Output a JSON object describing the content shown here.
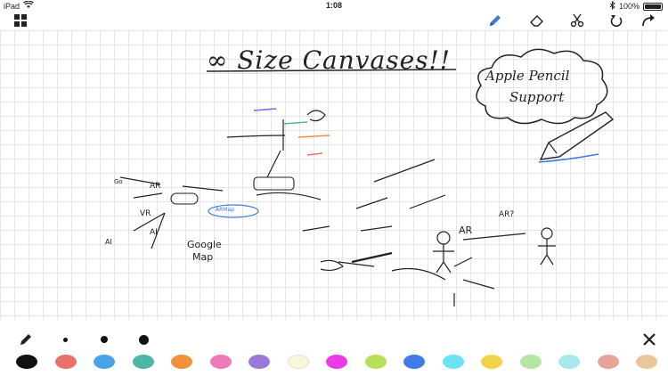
{
  "status_bar": {
    "device": "iPad",
    "time": "1:08",
    "battery_percent": "100%",
    "battery_level": 1.0,
    "icons": [
      "wifi-icon",
      "bluetooth-icon",
      "battery-icon"
    ]
  },
  "toolbar": {
    "left": [
      "grid-menu-icon"
    ],
    "right": [
      "pen-icon",
      "eraser-icon",
      "scissors-icon",
      "undo-icon",
      "redo-icon"
    ],
    "active_tool": "pen-icon",
    "active_color": "#3d7be0"
  },
  "canvas": {
    "title": "∞ Size Canvases!!",
    "cloud_line1": "Apple Pencil",
    "cloud_line2": "Support",
    "notes": [
      "ARMap",
      "AR",
      "VR",
      "AI",
      "Google",
      "Map",
      "AR",
      "AI",
      "AR?",
      "Go"
    ]
  },
  "bottom_bar": {
    "pen_sizes": [
      "pen-size-icon",
      "small",
      "medium",
      "large"
    ],
    "clear_icon": "close-icon",
    "swatches": [
      "#111111",
      "#e8716b",
      "#4aa3e8",
      "#4db6a4",
      "#f0903a",
      "#ee7bb5",
      "#9b79d8",
      "#f8f6dc",
      "#e93be8",
      "#b6e05a",
      "#3f7ce8",
      "#6ae3f4",
      "#f2d24a",
      "#b3e6a0",
      "#a8e7ea",
      "#e5a39c",
      "#e8c79a"
    ]
  }
}
